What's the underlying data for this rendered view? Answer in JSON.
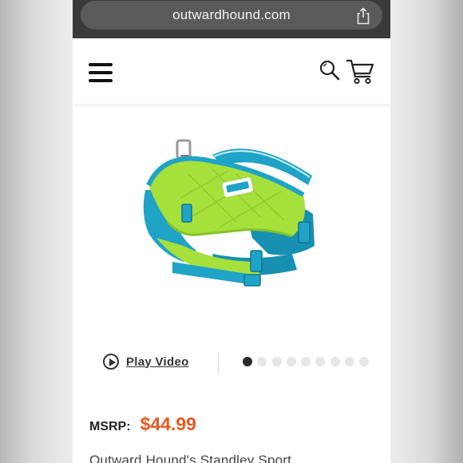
{
  "browser": {
    "url": "outwardhound.com"
  },
  "header": {
    "menu_icon": "hamburger-menu-icon",
    "search_icon": "search-icon",
    "cart_icon": "cart-icon"
  },
  "product": {
    "image_alt": "dog life jacket",
    "brand_label": "outward hound",
    "play_video_label": "Play Video",
    "carousel": {
      "total": 9,
      "active": 1
    },
    "msrp_label": "MSRP:",
    "price": "$44.99",
    "title": "Outward Hound's Standley Sport"
  },
  "colors": {
    "price": "#e55a20",
    "vest_green": "#a6e03a",
    "vest_blue": "#1fa3c6"
  }
}
